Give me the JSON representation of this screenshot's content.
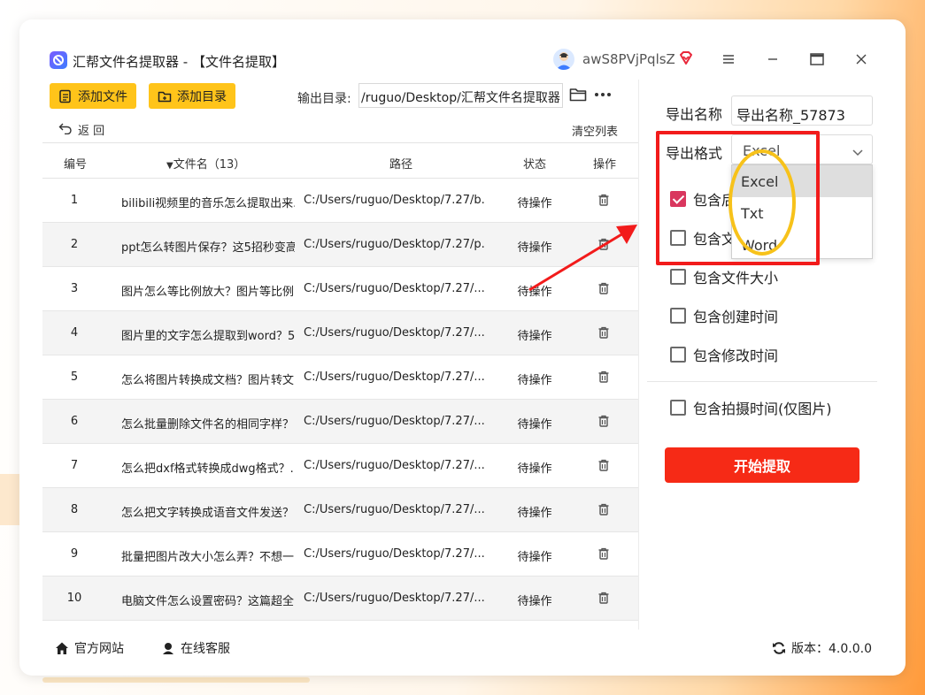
{
  "app": {
    "title": "汇帮文件名提取器 - 【文件名提取】",
    "username": "awS8PVjPqlsZ"
  },
  "toolbar": {
    "add_file": "添加文件",
    "add_dir": "添加目录",
    "output_label": "输出目录:",
    "output_path": "/ruguo/Desktop/汇帮文件名提取器",
    "back": "返  回",
    "clear": "清空列表"
  },
  "table": {
    "headers": {
      "no": "编号",
      "name": "文件名（13）",
      "path": "路径",
      "status": "状态",
      "op": "操作"
    },
    "rows": [
      {
        "no": "1",
        "name": "bilibili视频里的音乐怎么提取出来...",
        "path": "C:/Users/ruguo/Desktop/7.27/b...",
        "status": "待操作"
      },
      {
        "no": "2",
        "name": "ppt怎么转图片保存？这5招秒变高...",
        "path": "C:/Users/ruguo/Desktop/7.27/p...",
        "status": "待操作"
      },
      {
        "no": "3",
        "name": "图片怎么等比例放大？图片等比例...",
        "path": "C:/Users/ruguo/Desktop/7.27/...",
        "status": "待操作"
      },
      {
        "no": "4",
        "name": "图片里的文字怎么提取到word？5...",
        "path": "C:/Users/ruguo/Desktop/7.27/...",
        "status": "待操作"
      },
      {
        "no": "5",
        "name": "怎么将图片转换成文档？图片转文...",
        "path": "C:/Users/ruguo/Desktop/7.27/...",
        "status": "待操作"
      },
      {
        "no": "6",
        "name": "怎么批量删除文件名的相同字样？...",
        "path": "C:/Users/ruguo/Desktop/7.27/...",
        "status": "待操作"
      },
      {
        "no": "7",
        "name": "怎么把dxf格式转换成dwg格式？...",
        "path": "C:/Users/ruguo/Desktop/7.27/...",
        "status": "待操作"
      },
      {
        "no": "8",
        "name": "怎么把文字转换成语音文件发送？...",
        "path": "C:/Users/ruguo/Desktop/7.27/...",
        "status": "待操作"
      },
      {
        "no": "9",
        "name": "批量把图片改大小怎么弄？不想一...",
        "path": "C:/Users/ruguo/Desktop/7.27/...",
        "status": "待操作"
      },
      {
        "no": "10",
        "name": "电脑文件怎么设置密码？这篇超全...",
        "path": "C:/Users/ruguo/Desktop/7.27/...",
        "status": "待操作"
      }
    ]
  },
  "panel": {
    "export_name_label": "导出名称",
    "export_name_value": "导出名称_57873",
    "export_format_label": "导出格式",
    "export_format_value": "Excel",
    "format_options": [
      "Excel",
      "Txt",
      "Word"
    ],
    "selected_option": "Excel",
    "checkboxes": [
      {
        "label": "包含后",
        "checked": true
      },
      {
        "label": "包含文",
        "checked": false
      },
      {
        "label": "包含文件大小",
        "checked": false
      },
      {
        "label": "包含创建时间",
        "checked": false
      },
      {
        "label": "包含修改时间",
        "checked": false
      },
      {
        "label": "包含拍摄时间(仅图片)",
        "checked": false
      }
    ],
    "start_button": "开始提取"
  },
  "footer": {
    "website": "官方网站",
    "support": "在线客服",
    "version": "版本：4.0.0.0"
  },
  "icons": {
    "logo": "app-logo-icon",
    "avatar": "avatar-icon",
    "vip": "diamond-icon",
    "menu": "hamburger-icon",
    "minimize": "minimize-icon",
    "maximize": "maximize-icon",
    "close": "close-icon",
    "trash": "trash-icon",
    "folder": "folder-icon",
    "more": "more-icon",
    "home": "home-icon",
    "support": "headset-icon",
    "refresh": "refresh-icon"
  },
  "colors": {
    "accent_yellow": "#ffc41a",
    "start_red": "#f62a16",
    "checkbox_on": "#d9365e",
    "annotation_red": "#f21b1b",
    "annotation_yellow": "#f7c21a"
  }
}
